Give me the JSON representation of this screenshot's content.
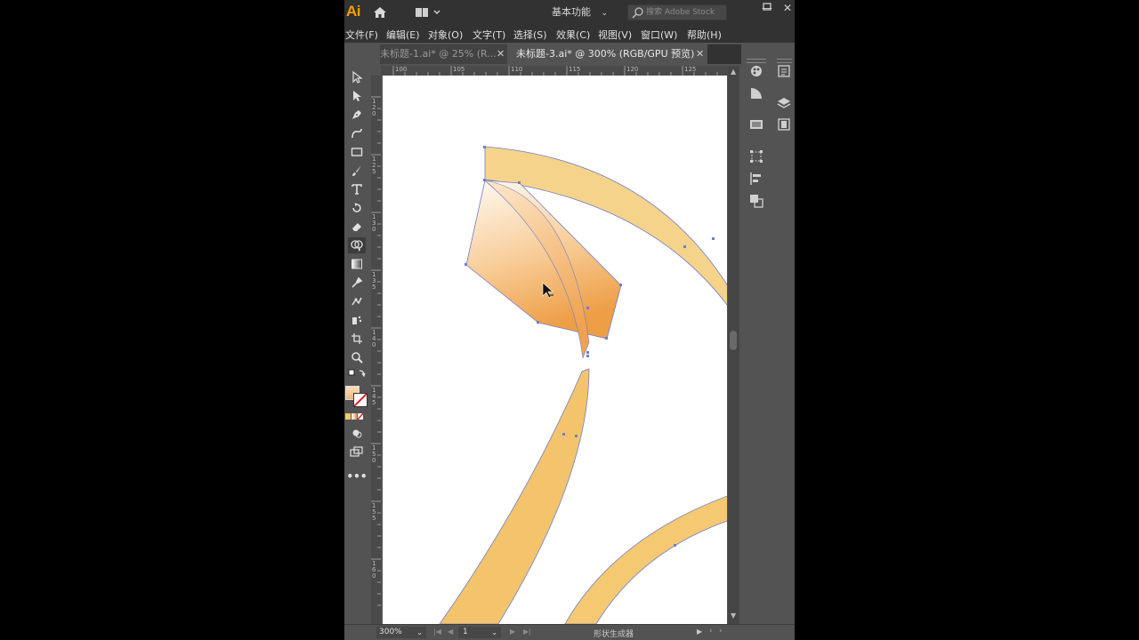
{
  "app": {
    "logo": "Ai",
    "workspace": "基本功能",
    "search_placeholder": "搜索 Adobe Stock"
  },
  "menu": [
    "文件(F)",
    "编辑(E)",
    "对象(O)",
    "文字(T)",
    "选择(S)",
    "效果(C)",
    "视图(V)",
    "窗口(W)",
    "帮助(H)"
  ],
  "tabs": [
    {
      "label": "未标题-1.ai* @ 25% (R...",
      "active": false
    },
    {
      "label": "未标题-3.ai* @ 300% (RGB/GPU 预览)",
      "active": true
    }
  ],
  "ruler_top": [
    "100",
    "105",
    "110",
    "115",
    "120",
    "125"
  ],
  "ruler_left": [
    "120",
    "125",
    "130",
    "135",
    "140",
    "145",
    "150",
    "155",
    "160"
  ],
  "status": {
    "zoom": "300%",
    "page": "1",
    "tool_name": "形状生成器"
  },
  "colors": {
    "accent": "#ff9a00",
    "ribbon": "#f5c872",
    "stroke": "#6f7fc8"
  },
  "tools": [
    "selection-tool",
    "direct-selection-tool",
    "pen-tool",
    "curvature-tool",
    "rectangle-tool",
    "paintbrush-tool",
    "type-tool",
    "rotate-tool",
    "eraser-tool",
    "shape-builder-tool",
    "gradient-tool",
    "eyedropper-tool",
    "puppet-warp-tool",
    "symbol-sprayer-tool",
    "artboard-tool",
    "zoom-tool"
  ]
}
